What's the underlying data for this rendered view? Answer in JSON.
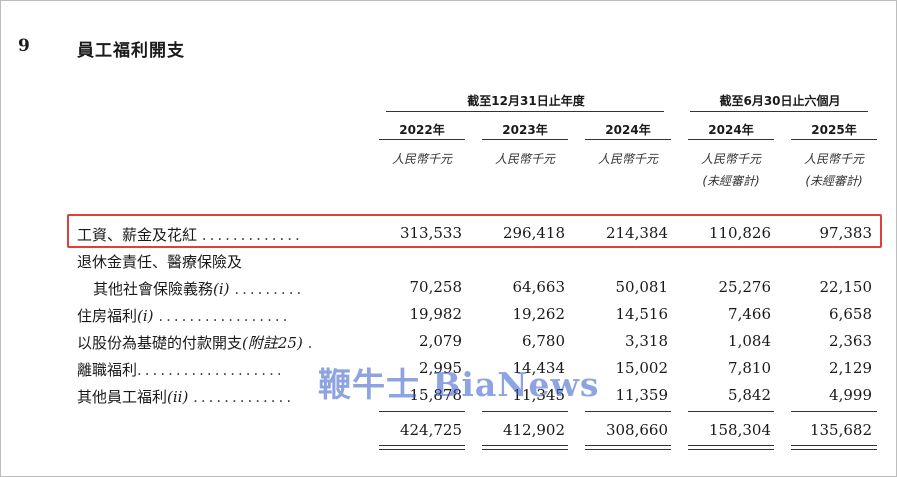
{
  "section": {
    "number": "9",
    "title": "員工福利開支"
  },
  "header": {
    "group1": "截至12月31日止年度",
    "group2": "截至6月30日止六個月",
    "years": [
      "2022年",
      "2023年",
      "2024年",
      "2024年",
      "2025年"
    ],
    "units": [
      "人民幣千元",
      "人民幣千元",
      "人民幣千元",
      "人民幣千元",
      "人民幣千元"
    ],
    "units2": [
      "",
      "",
      "",
      "(未經審計)",
      "(未經審計)"
    ]
  },
  "rows": [
    {
      "label": "工資、薪金及花紅",
      "note": "",
      "values": [
        "313,533",
        "296,418",
        "214,384",
        "110,826",
        "97,383"
      ]
    },
    {
      "label": "退休金責任、醫療保險及",
      "note": "",
      "values": [
        "",
        "",
        "",
        "",
        ""
      ]
    },
    {
      "label": "其他社會保險義務",
      "note": "(i)",
      "values": [
        "70,258",
        "64,663",
        "50,081",
        "25,276",
        "22,150"
      ]
    },
    {
      "label": "住房福利",
      "note": "(i)",
      "values": [
        "19,982",
        "19,262",
        "14,516",
        "7,466",
        "6,658"
      ]
    },
    {
      "label": "以股份為基礎的付款開支",
      "note": "(附註25)",
      "values": [
        "2,079",
        "6,780",
        "3,318",
        "1,084",
        "2,363"
      ]
    },
    {
      "label": "離職福利",
      "note": "",
      "values": [
        "2,995",
        "14,434",
        "15,002",
        "7,810",
        "2,129"
      ]
    },
    {
      "label": "其他員工福利",
      "note": "(ii)",
      "values": [
        "15,878",
        "11,345",
        "11,359",
        "5,842",
        "4,999"
      ]
    }
  ],
  "totals": [
    "424,725",
    "412,902",
    "308,660",
    "158,304",
    "135,682"
  ],
  "watermark": "鞭牛士 BiaNews",
  "colors": {
    "highlight": "#e0403a",
    "watermark": "#325ac8"
  }
}
